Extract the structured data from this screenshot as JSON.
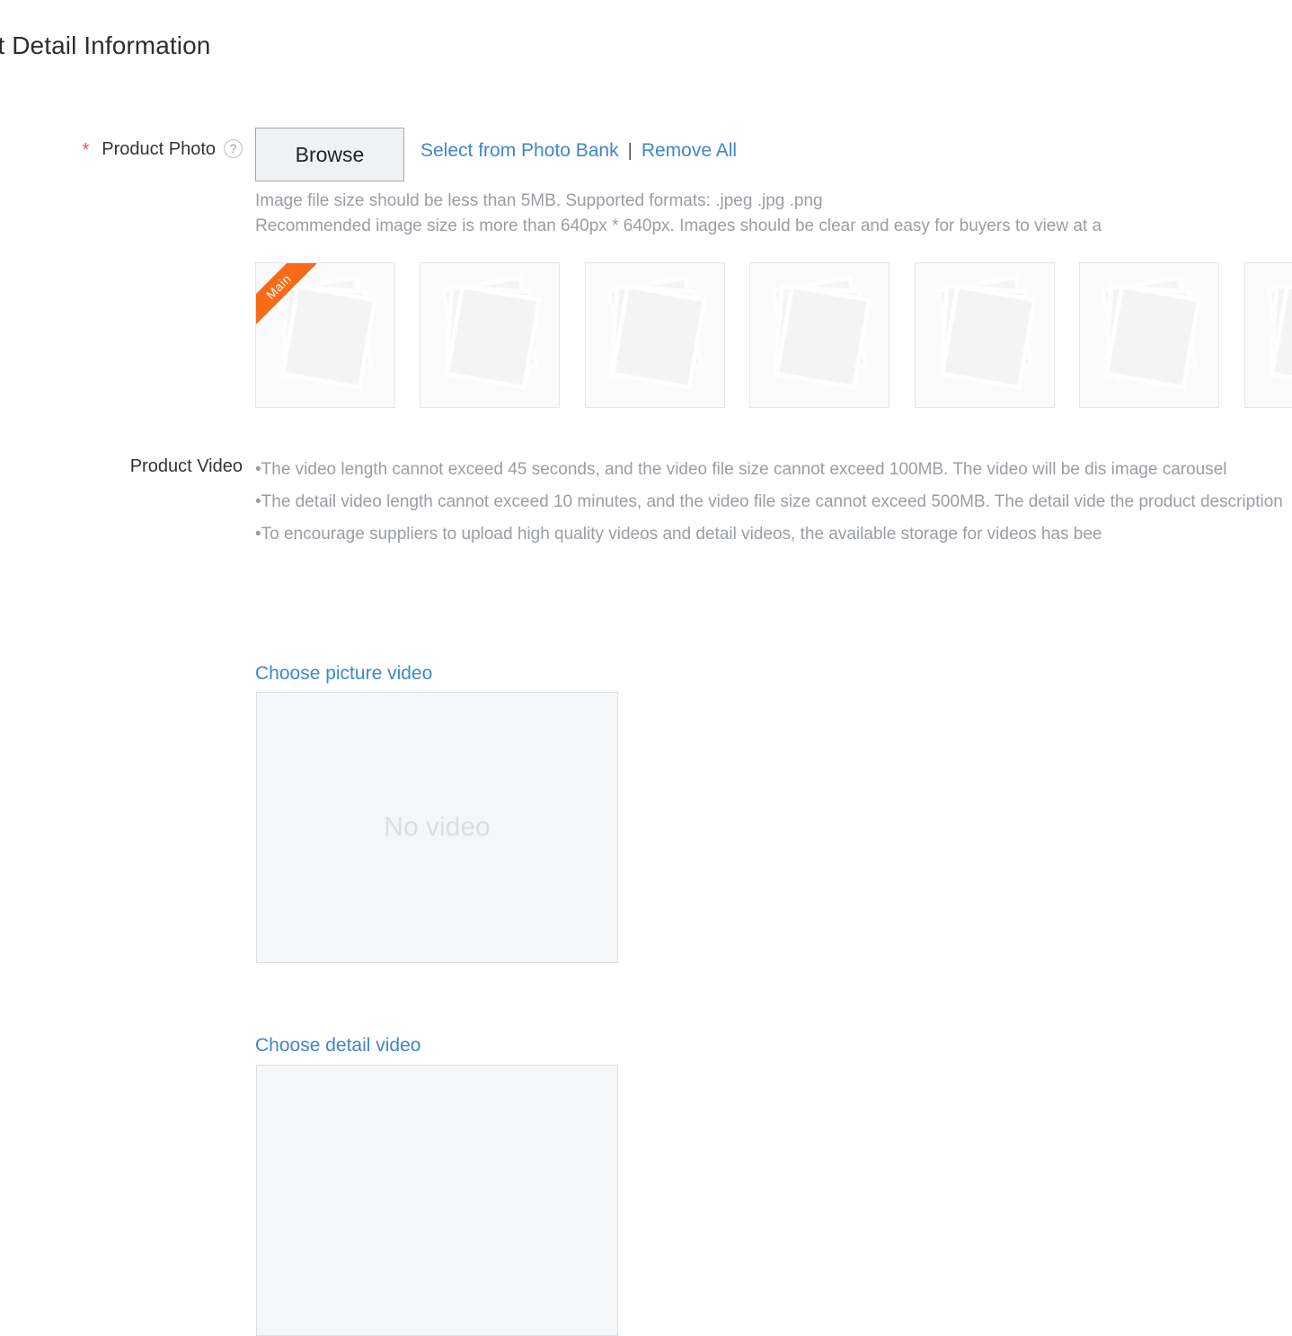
{
  "section": {
    "title": "duct Detail Information"
  },
  "product_photo": {
    "label": "Product Photo",
    "required_marker": "*",
    "help_icon": "question-mark-icon",
    "browse_label": "Browse",
    "select_from_photo_bank_label": "Select from Photo Bank",
    "separator": "|",
    "remove_all_label": "Remove All",
    "hints": [
      "Image file size should be less than 5MB. Supported formats: .jpeg .jpg .png",
      "Recommended image size is more than 640px * 640px. Images should be clear and easy for buyers to view at a"
    ],
    "main_badge_label": "Main",
    "thumbnails": [
      {
        "is_main": true,
        "state": "empty"
      },
      {
        "is_main": false,
        "state": "empty"
      },
      {
        "is_main": false,
        "state": "empty"
      },
      {
        "is_main": false,
        "state": "empty"
      },
      {
        "is_main": false,
        "state": "empty"
      },
      {
        "is_main": false,
        "state": "empty"
      },
      {
        "is_main": false,
        "state": "empty"
      }
    ]
  },
  "product_video": {
    "label": "Product Video",
    "notes": [
      "•The video length cannot exceed 45 seconds, and the video file size cannot exceed 100MB. The video will be dis image carousel",
      "•The detail video length cannot exceed 10 minutes, and the video file size cannot exceed 500MB. The detail vide the product description",
      "•To encourage suppliers to upload high quality videos and detail videos, the available storage for videos has bee"
    ],
    "picture_video": {
      "link_label": "Choose picture video",
      "empty_text": "No video"
    },
    "detail_video": {
      "link_label": "Choose detail video",
      "empty_text": ""
    }
  },
  "colors": {
    "link_blue": "#3f87ca",
    "required_red": "#e1515b",
    "main_badge_orange": "#f96a16",
    "hint_gray": "#9a9ea3",
    "text_dark": "#333333",
    "panel_gray": "#f5f6f7"
  }
}
